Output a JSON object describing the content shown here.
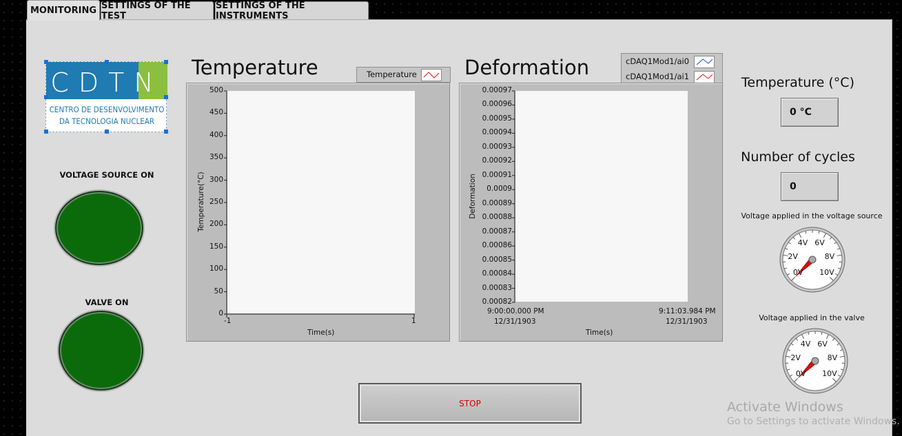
{
  "tabs": [
    {
      "label": "MONITORING",
      "active": true
    },
    {
      "label": "SETTINGS OF THE TEST",
      "active": false
    },
    {
      "label": "SETTINGS OF THE INSTRUMENTS",
      "active": false
    }
  ],
  "logo": {
    "text": "CDTN",
    "line1": "CENTRO DE DESENVOLVIMENTO",
    "line2": "DA TECNOLOGIA NUCLEAR",
    "colors": {
      "blue": "#1f7bb2",
      "green": "#8cbf3f"
    }
  },
  "leds": {
    "voltage_source": {
      "label": "VOLTAGE SOURCE ON",
      "state": "on",
      "color": "#0b6b0b"
    },
    "valve": {
      "label": "VALVE ON",
      "state": "on",
      "color": "#0b6b0b"
    }
  },
  "temperature_graph": {
    "title": "Temperature",
    "legend": [
      "Temperature"
    ],
    "ylabel": "Temperature(°C)",
    "xlabel": "Time(s)",
    "yticks": [
      "500",
      "450",
      "400",
      "350",
      "300",
      "250",
      "200",
      "150",
      "100",
      "50",
      "0"
    ],
    "xticks": [
      "-1",
      "1"
    ]
  },
  "deformation_graph": {
    "title": "Deformation",
    "legend": [
      "cDAQ1Mod1/ai0",
      "cDAQ1Mod1/ai1"
    ],
    "ylabel": "Deformation",
    "xlabel": "Time(s)",
    "yticks": [
      "0.00097",
      "0.00096",
      "0.00095",
      "0.00094",
      "0.00093",
      "0.00092",
      "0.00091",
      "0.0009",
      "0.00089",
      "0.00088",
      "0.00087",
      "0.00086",
      "0.00085",
      "0.00084",
      "0.00083",
      "0.00082"
    ],
    "x_start": {
      "time": "9:00:00.000 PM",
      "date": "12/31/1903"
    },
    "x_end": {
      "time": "9:11:03.984 PM",
      "date": "12/31/1903"
    }
  },
  "chart_data": [
    {
      "type": "line",
      "title": "Temperature",
      "xlabel": "Time(s)",
      "ylabel": "Temperature(°C)",
      "xlim": [
        -1,
        1
      ],
      "ylim": [
        0,
        500
      ],
      "series": [
        {
          "name": "Temperature",
          "values": []
        }
      ],
      "legend": "top-right",
      "grid": false
    },
    {
      "type": "line",
      "title": "Deformation",
      "xlabel": "Time(s)",
      "ylabel": "Deformation",
      "xlim": [
        "9:00:00.000 PM 12/31/1903",
        "9:11:03.984 PM 12/31/1903"
      ],
      "ylim": [
        0.00082,
        0.00097
      ],
      "series": [
        {
          "name": "cDAQ1Mod1/ai0",
          "values": []
        },
        {
          "name": "cDAQ1Mod1/ai1",
          "values": []
        }
      ],
      "legend": "top-right",
      "grid": false
    }
  ],
  "indicators": {
    "temperature": {
      "label": "Temperature (°C)",
      "value": "0 °C"
    },
    "cycles": {
      "label": "Number of cycles",
      "value": "0"
    }
  },
  "gauges": {
    "voltage_source": {
      "label": "Voltage applied in the voltage source",
      "ticks": [
        "0V",
        "2V",
        "4V",
        "6V",
        "8V",
        "10V"
      ],
      "value": 0
    },
    "valve": {
      "label": "Voltage applied in the valve",
      "ticks": [
        "0V",
        "2V",
        "4V",
        "6V",
        "8V",
        "10V"
      ],
      "value": 0
    }
  },
  "stop_button": {
    "label": "STOP"
  },
  "watermark": {
    "line1": "Activate Windows",
    "line2": "Go to Settings to activate Windows."
  }
}
